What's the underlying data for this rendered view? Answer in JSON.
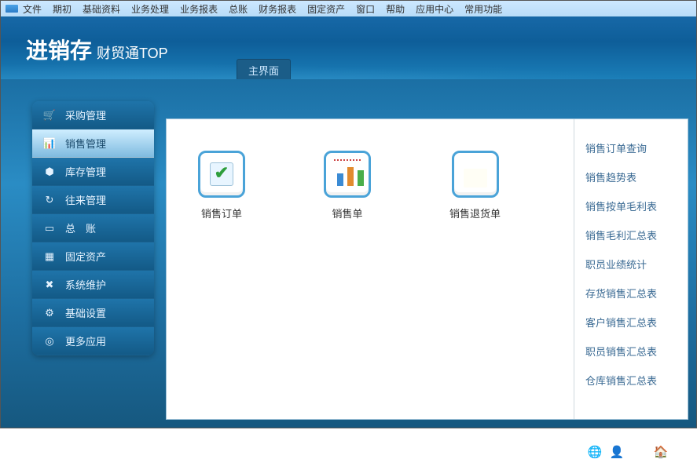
{
  "menu": [
    "文件",
    "期初",
    "基础资料",
    "业务处理",
    "业务报表",
    "总账",
    "财务报表",
    "固定资产",
    "窗口",
    "帮助",
    "应用中心",
    "常用功能"
  ],
  "brand": {
    "main": "进销存",
    "sub": "财贸通TOP"
  },
  "tab_main": "主界面",
  "toolbar_icons": [
    "globe-icon",
    "user-icon",
    "tag-icon",
    "home-icon",
    "new-icon"
  ],
  "sidebar": [
    {
      "icon": "cart-icon",
      "label": "采购管理",
      "active": false
    },
    {
      "icon": "chart-icon",
      "label": "销售管理",
      "active": true
    },
    {
      "icon": "home-solid-icon",
      "label": "库存管理",
      "active": false
    },
    {
      "icon": "refresh-icon",
      "label": "往来管理",
      "active": false
    },
    {
      "icon": "ledger-icon",
      "label": "总　账",
      "active": false
    },
    {
      "icon": "grid-icon",
      "label": "固定资产",
      "active": false
    },
    {
      "icon": "tools-icon",
      "label": "系统维护",
      "active": false
    },
    {
      "icon": "gear-icon",
      "label": "基础设置",
      "active": false
    },
    {
      "icon": "target-icon",
      "label": "更多应用",
      "active": false
    }
  ],
  "modules": [
    {
      "icon": "order",
      "label": "销售订单"
    },
    {
      "icon": "sale",
      "label": "销售单"
    },
    {
      "icon": "return",
      "label": "销售退货单"
    }
  ],
  "links": [
    "销售订单查询",
    "销售趋势表",
    "销售按单毛利表",
    "销售毛利汇总表",
    "职员业绩统计",
    "存货销售汇总表",
    "客户销售汇总表",
    "职员销售汇总表",
    "仓库销售汇总表"
  ],
  "icon_glyphs": {
    "cart-icon": "🛒",
    "chart-icon": "📊",
    "home-solid-icon": "⬢",
    "refresh-icon": "↻",
    "ledger-icon": "▭",
    "grid-icon": "▦",
    "tools-icon": "✖",
    "gear-icon": "⚙",
    "target-icon": "◎",
    "globe-icon": "🌐",
    "user-icon": "👤",
    "tag-icon": "🏷",
    "home-icon": "🏠",
    "new-icon": "▢"
  }
}
